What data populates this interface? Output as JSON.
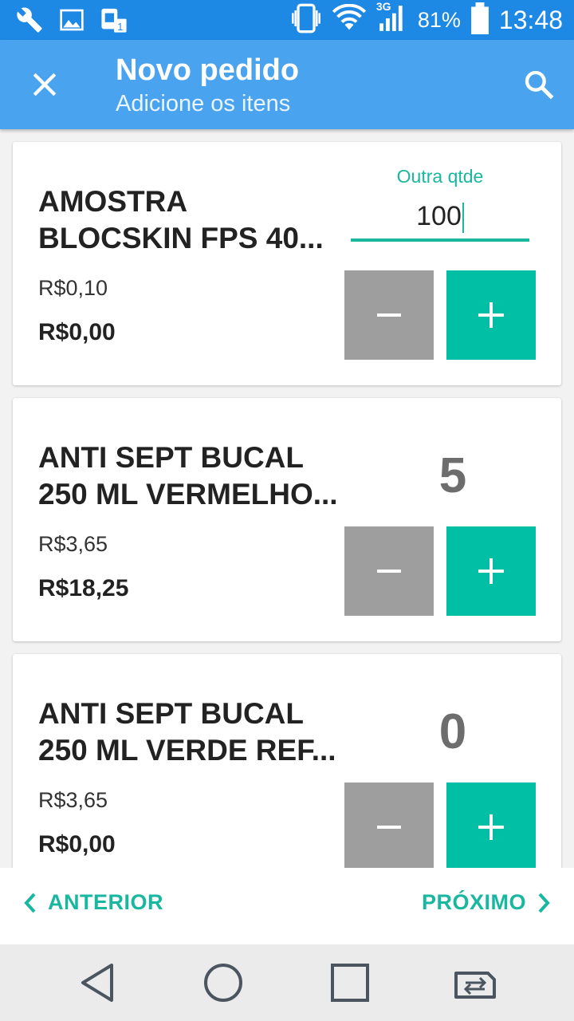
{
  "status_bar": {
    "icons": [
      "wrench-icon",
      "image-icon",
      "sim-lock-icon",
      "vibrate-icon",
      "wifi-icon",
      "signal-3g-icon",
      "battery-icon"
    ],
    "network": "3G",
    "battery": "81%",
    "time": "13:48"
  },
  "appbar": {
    "title": "Novo pedido",
    "subtitle": "Adicione os itens",
    "close_icon": "close-icon",
    "search_icon": "search-icon"
  },
  "items": [
    {
      "name_line1": "AMOSTRA",
      "name_line2": "BLOCSKIN FPS 40...",
      "unit_price": "R$0,10",
      "total": "R$0,00",
      "qty_label": "Outra qtde",
      "qty_value": "100"
    },
    {
      "name_line1": "ANTI SEPT BUCAL",
      "name_line2": "250 ML VERMELHO...",
      "unit_price": "R$3,65",
      "total": "R$18,25",
      "qty": "5"
    },
    {
      "name_line1": "ANTI SEPT BUCAL",
      "name_line2": "250 ML VERDE REF...",
      "unit_price": "R$3,65",
      "total": "R$0,00",
      "qty": "0"
    }
  ],
  "pager": {
    "prev_label": "ANTERIOR",
    "next_label": "PRÓXIMO"
  },
  "navbar": {
    "icons": [
      "back-icon",
      "home-icon",
      "recents-icon",
      "switch-sim-icon"
    ]
  },
  "colors": {
    "status_bar": "#1e88e5",
    "app_bar": "#4aa3ee",
    "accent": "#00bfa5",
    "minus_button": "#9e9e9e"
  }
}
